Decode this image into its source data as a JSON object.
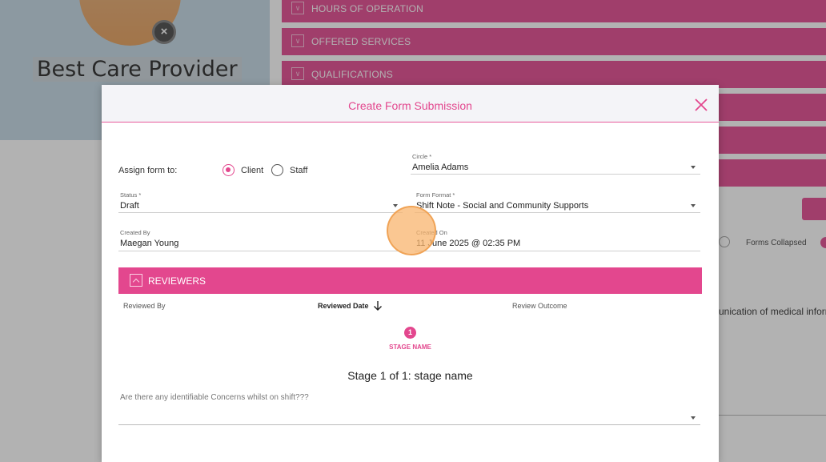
{
  "background": {
    "provider_name": "Best Care Provider",
    "sections": [
      "HOURS OF OPERATION",
      "OFFERED SERVICES",
      "QUALIFICATIONS"
    ],
    "forms_collapsed_label": "Forms Collapsed",
    "snippet_text": "unication of medical inform"
  },
  "modal": {
    "title": "Create Form Submission",
    "assign_label": "Assign form to:",
    "assign_options": [
      "Client",
      "Staff"
    ],
    "assign_selected": "Client",
    "circle": {
      "label": "Circle *",
      "value": "Amelia Adams"
    },
    "status": {
      "label": "Status *",
      "value": "Draft"
    },
    "form_format": {
      "label": "Form Format *",
      "value": "Shift Note - Social and Community Supports"
    },
    "created_by": {
      "label": "Created By",
      "value": "Maegan Young"
    },
    "created_on": {
      "label": "Created On",
      "value": "11 June 2025 @ 02:35 PM"
    },
    "reviewers": {
      "title": "REVIEWERS",
      "columns": [
        "Reviewed By",
        "Reviewed Date",
        "Review Outcome"
      ]
    },
    "stage": {
      "number": "1",
      "name": "STAGE NAME",
      "heading": "Stage 1 of 1: stage name"
    },
    "question": "Are there any identifiable Concerns whilst on shift???"
  },
  "colors": {
    "accent": "#e3478e",
    "band": "#e6599a"
  }
}
